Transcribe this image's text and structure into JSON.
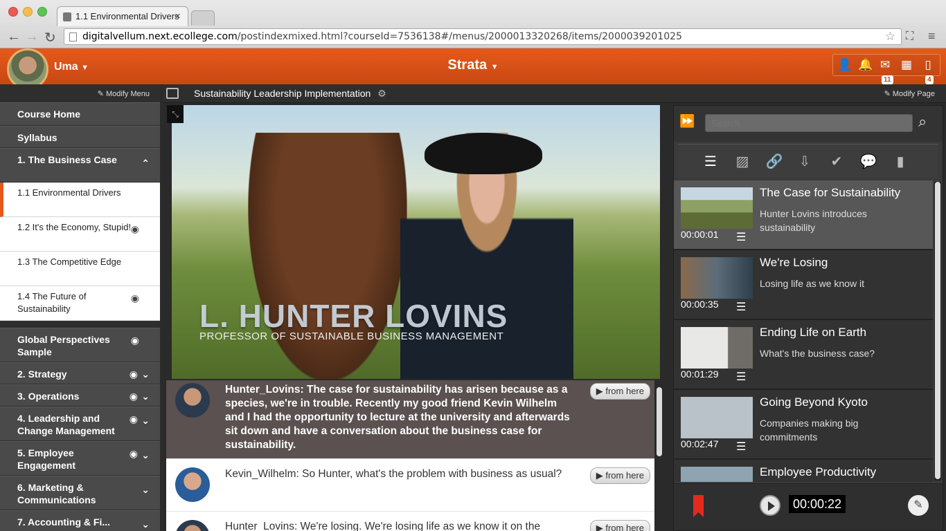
{
  "browser": {
    "tab_title": "1.1 Environmental Drivers",
    "url_domain": "digitalvellum.next.ecollege.com",
    "url_path": "/postindexmixed.html?courseId=7536138#/menus/2000013320268/items/2000039201025"
  },
  "header": {
    "user_name": "Uma",
    "app_title": "Strata",
    "mail_count": "11",
    "doc_count": "4"
  },
  "sidebar": {
    "modify_menu": "Modify Menu",
    "top_items": [
      "Course Home",
      "Syllabus"
    ],
    "section_open": "1. The Business Case",
    "subitems": [
      {
        "label": "1.1 Environmental Drivers"
      },
      {
        "label": "1.2 It's the Economy, Stupid!"
      },
      {
        "label": "1.3 The Competitive Edge"
      },
      {
        "label": "1.4 The Future of Sustainability"
      }
    ],
    "sections": [
      {
        "label": "Global Perspectives Sample"
      },
      {
        "label": "2. Strategy"
      },
      {
        "label": "3. Operations"
      },
      {
        "label": "4. Leadership and Change Management"
      },
      {
        "label": "5. Employee Engagement"
      },
      {
        "label": "6. Marketing & Communications"
      },
      {
        "label": "7. Accounting & Fi..."
      }
    ]
  },
  "page": {
    "breadcrumb": "Sustainability Leadership Implementation",
    "modify_page": "Modify Page"
  },
  "video": {
    "name_overlay": "L. HUNTER LOVINS",
    "title_overlay": "PROFESSOR OF SUSTAINABLE BUSINESS MANAGEMENT"
  },
  "transcript": {
    "from_here": "from here",
    "rows": [
      {
        "text": "Hunter_Lovins: The case for sustainability has arisen because as a species, we're in trouble. Recently my good friend Kevin Wilhelm and I had the opportunity to lecture at the university and afterwards sit down and have a conversation about the business case for sustainability."
      },
      {
        "text": "Kevin_Wilhelm: So Hunter, what's the problem with business as usual?"
      },
      {
        "text": "Hunter_Lovins: We're losing. We're losing life as we know it on the"
      }
    ]
  },
  "chapters": {
    "search_placeholder": "Search",
    "items": [
      {
        "title": "The Case for Sustainability",
        "desc": "Hunter Lovins introduces sustainability",
        "time": "00:00:01"
      },
      {
        "title": "We're Losing",
        "desc": "Losing life as we know it",
        "time": "00:00:35"
      },
      {
        "title": "Ending Life on Earth",
        "desc": "What's the business case?",
        "time": "00:01:29"
      },
      {
        "title": "Going Beyond Kyoto",
        "desc": "Companies making big commitments",
        "time": "00:02:47"
      },
      {
        "title": "Employee Productivity",
        "desc": "",
        "time": ""
      }
    ],
    "current_time": "00:00:22"
  }
}
